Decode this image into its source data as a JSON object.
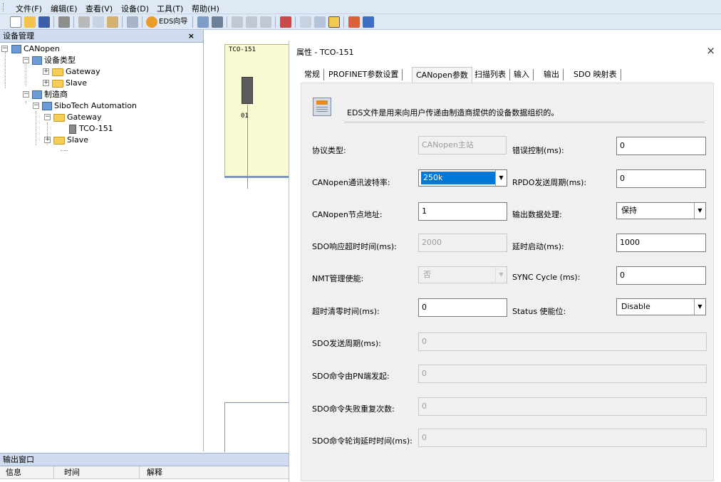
{
  "menu": {
    "items": [
      "文件(F)",
      "编辑(E)",
      "查看(V)",
      "设备(D)",
      "工具(T)",
      "帮助(H)"
    ]
  },
  "toolbar": {
    "eds_wizard_label": "EDS向导"
  },
  "device_panel": {
    "title": "设备管理",
    "close": "×",
    "tree": {
      "root": "CANopen",
      "device_types": "设备类型",
      "gateway": "Gateway",
      "slave": "Slave",
      "manufacturer": "制造商",
      "vendor": "SiboTech Automation",
      "vendor_gateway": "Gateway",
      "device": "TCO-151",
      "vendor_slave": "Slave"
    }
  },
  "canvas": {
    "device_title": "TCO-151",
    "device_slot": "01"
  },
  "output": {
    "title": "输出窗口",
    "columns": [
      "信息",
      "时间",
      "解释"
    ]
  },
  "dialog": {
    "title": "属性 - TCO-151",
    "close": "×",
    "tabs": [
      "常规",
      "PROFINET参数设置",
      "CANopen参数",
      "扫描列表",
      "输入",
      "输出",
      "SDO 映射表"
    ],
    "selected_tab": 2,
    "eds_note": "EDS文件是用来向用户传递由制造商提供的设备数据组织的。",
    "left": [
      {
        "label": "协议类型:",
        "value": "CANopen主站",
        "disabled": true,
        "kind": "text"
      },
      {
        "label": "CANopen通讯波特率:",
        "value": "250k",
        "disabled": false,
        "kind": "combo"
      },
      {
        "label": "CANopen节点地址:",
        "value": "1",
        "disabled": false,
        "kind": "text"
      },
      {
        "label": "SDO响应超时时间(ms):",
        "value": "2000",
        "disabled": true,
        "kind": "text"
      },
      {
        "label": "NMT管理使能:",
        "value": "否",
        "disabled": true,
        "kind": "combo"
      },
      {
        "label": "超时清零时间(ms):",
        "value": "0",
        "disabled": false,
        "kind": "text"
      }
    ],
    "right": [
      {
        "label": "错误控制(ms):",
        "value": "0",
        "kind": "text"
      },
      {
        "label": "RPDO发送周期(ms):",
        "value": "0",
        "kind": "text"
      },
      {
        "label": "输出数据处理:",
        "value": "保持",
        "kind": "combo"
      },
      {
        "label": "延时启动(ms):",
        "value": "1000",
        "kind": "text"
      },
      {
        "label": "SYNC Cycle (ms):",
        "value": "0",
        "kind": "text"
      },
      {
        "label": "Status 使能位:",
        "value": "Disable",
        "kind": "combo"
      }
    ],
    "wide": [
      {
        "label": "SDO发送周期(ms):",
        "value": "0"
      },
      {
        "label": "SDO命令由PN端发起:",
        "value": "0"
      },
      {
        "label": "SDO命令失败重复次数:",
        "value": "0"
      },
      {
        "label": "SDO命令轮询延时时间(ms):",
        "value": "0"
      }
    ]
  }
}
